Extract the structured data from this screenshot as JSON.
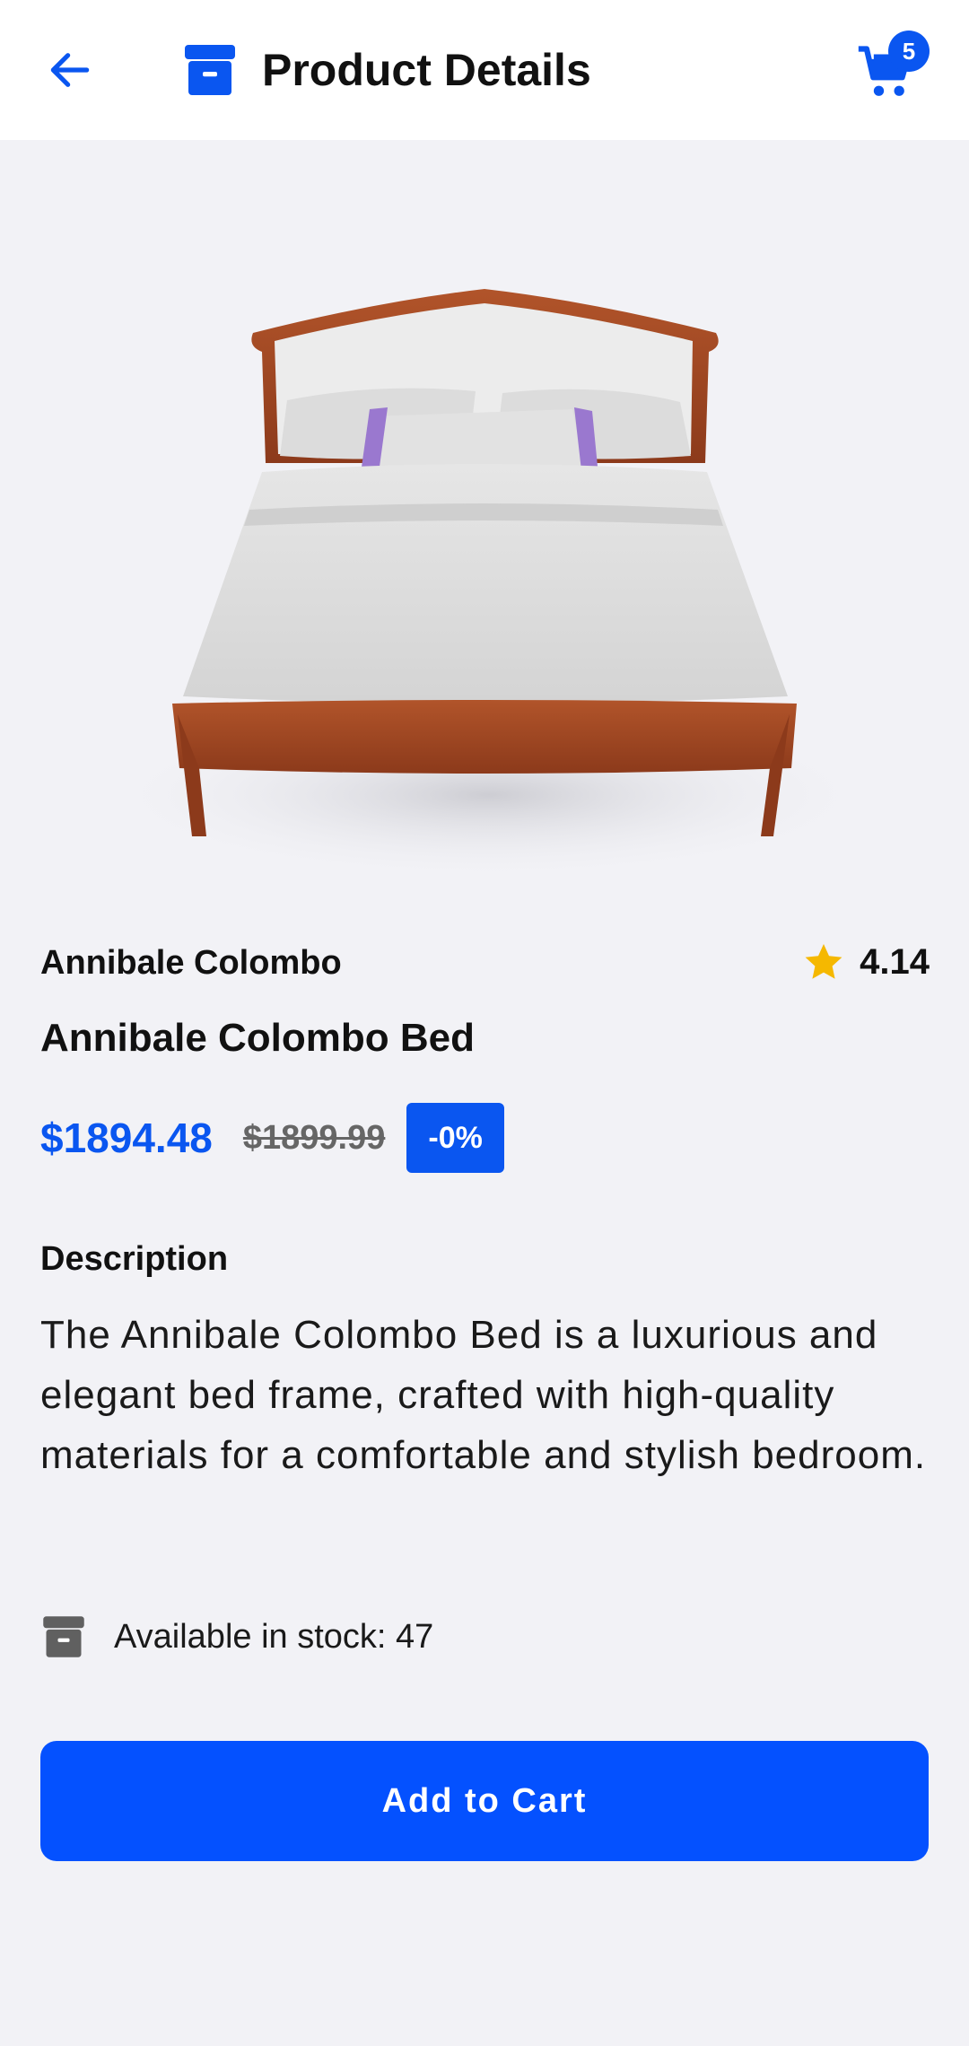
{
  "header": {
    "title": "Product Details",
    "cart_count": "5"
  },
  "product": {
    "brand": "Annibale Colombo",
    "rating": "4.14",
    "name": "Annibale Colombo Bed",
    "price": "$1894.48",
    "original_price": "$1899.99",
    "discount": "-0%",
    "description_heading": "Description",
    "description": "The Annibale Colombo Bed is a luxurious and elegant bed frame, crafted with high-quality materials for a comfortable and stylish bedroom.",
    "stock_text": "Available in stock: 47"
  },
  "actions": {
    "add_to_cart": "Add to Cart"
  },
  "icons": {
    "back": "arrow-left-icon",
    "title": "archive-box-icon",
    "cart": "cart-icon",
    "rating": "star-icon",
    "stock": "archive-box-icon"
  },
  "colors": {
    "accent": "#0a56f0",
    "button": "#0451ff",
    "star": "#f5b800",
    "background": "#f2f2f6"
  }
}
